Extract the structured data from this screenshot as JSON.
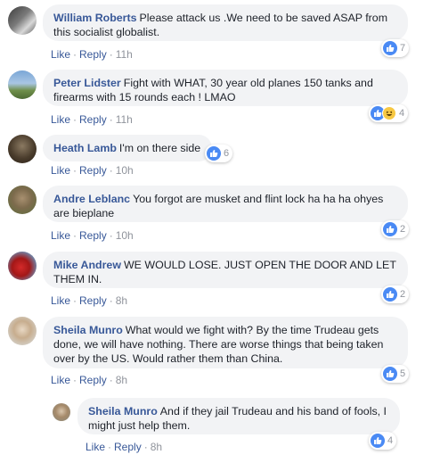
{
  "comments": [
    {
      "author": "William Roberts",
      "text": "Please attack us .We need to be saved ASAP from this socialist globalist.",
      "like": "Like",
      "reply": "Reply",
      "time": "11h",
      "reaction_count": "7",
      "reactions": [
        "like-icon"
      ]
    },
    {
      "author": "Peter Lidster",
      "text": "Fight with WHAT, 30 year old planes 150 tanks and firearms with 15 rounds each ! LMAO",
      "like": "Like",
      "reply": "Reply",
      "time": "11h",
      "reaction_count": "4",
      "reactions": [
        "like-icon",
        "haha-icon"
      ]
    },
    {
      "author": "Heath Lamb",
      "text": "I'm on there side",
      "like": "Like",
      "reply": "Reply",
      "time": "10h",
      "reaction_count": "6",
      "reactions": [
        "like-icon"
      ]
    },
    {
      "author": "Andre Leblanc",
      "text": "You forgot are musket and flint lock ha ha ha ohyes are bieplane",
      "like": "Like",
      "reply": "Reply",
      "time": "10h",
      "reaction_count": "2",
      "reactions": [
        "like-icon"
      ]
    },
    {
      "author": "Mike Andrew",
      "text": "WE WOULD LOSE. JUST OPEN THE DOOR AND LET THEM IN.",
      "like": "Like",
      "reply": "Reply",
      "time": "8h",
      "reaction_count": "2",
      "reactions": [
        "like-icon"
      ]
    },
    {
      "author": "Sheila Munro",
      "text": "What would we fight with? By the time Trudeau gets done, we will have nothing. There are worse things that being taken over by the US. Would rather them than China.",
      "like": "Like",
      "reply": "Reply",
      "time": "8h",
      "reaction_count": "5",
      "reactions": [
        "like-icon"
      ]
    },
    {
      "author": "Sheila Munro",
      "text": "And if they jail Trudeau and his band of fools, I might just help them.",
      "like": "Like",
      "reply": "Reply",
      "time": "8h",
      "reaction_count": "4",
      "reactions": [
        "like-icon"
      ]
    }
  ],
  "colors": {
    "author": "#385898",
    "bubble": "#f2f3f5",
    "meta": "#90949c",
    "like_blue": "#4a8af4"
  }
}
